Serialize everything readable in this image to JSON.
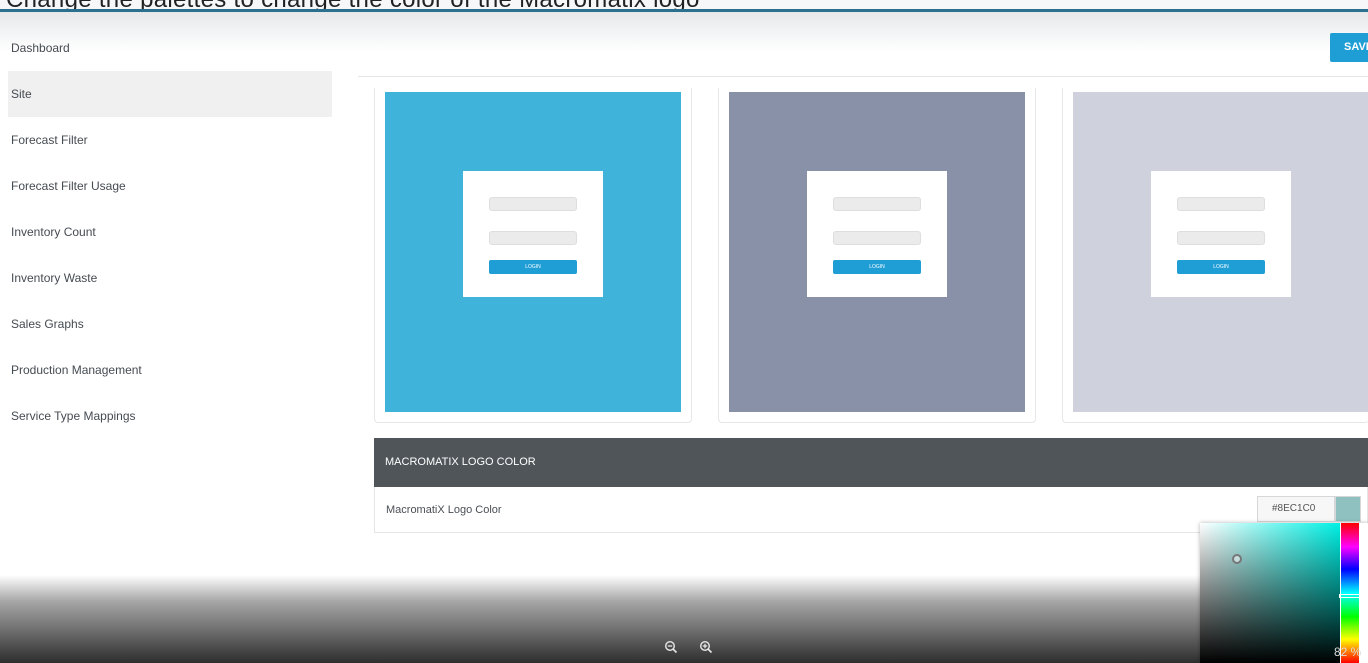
{
  "top_caption": "Change the palettes to change the color of the Macromatix logo",
  "sidebar": {
    "items": [
      {
        "label": "Dashboard"
      },
      {
        "label": "Site"
      },
      {
        "label": "Forecast Filter"
      },
      {
        "label": "Forecast Filter Usage"
      },
      {
        "label": "Inventory Count"
      },
      {
        "label": "Inventory Waste"
      },
      {
        "label": "Sales Graphs"
      },
      {
        "label": "Production Management"
      },
      {
        "label": "Service Type Mappings"
      }
    ],
    "active_index": 1
  },
  "toolbar": {
    "save_label": "SAVE"
  },
  "themes": [
    {
      "color": "#3fb3d9",
      "login_label": "LOGIN"
    },
    {
      "color": "#8891a8",
      "login_label": "LOGIN"
    },
    {
      "color": "#cfd1dd",
      "login_label": "LOGIN"
    }
  ],
  "logo_panel": {
    "header": "MACROMATIX LOGO COLOR",
    "field_label": "MacromatiX Logo Color",
    "hex_value": "#8EC1C0",
    "swatch_color": "#8ec1c0"
  },
  "viewer": {
    "zoom_out_icon": "zoom-out-icon",
    "zoom_in_icon": "zoom-in-icon",
    "zoom_level": "82 %"
  },
  "colors": {
    "accent": "#1f9ed6",
    "panel_header": "#4f5558"
  }
}
